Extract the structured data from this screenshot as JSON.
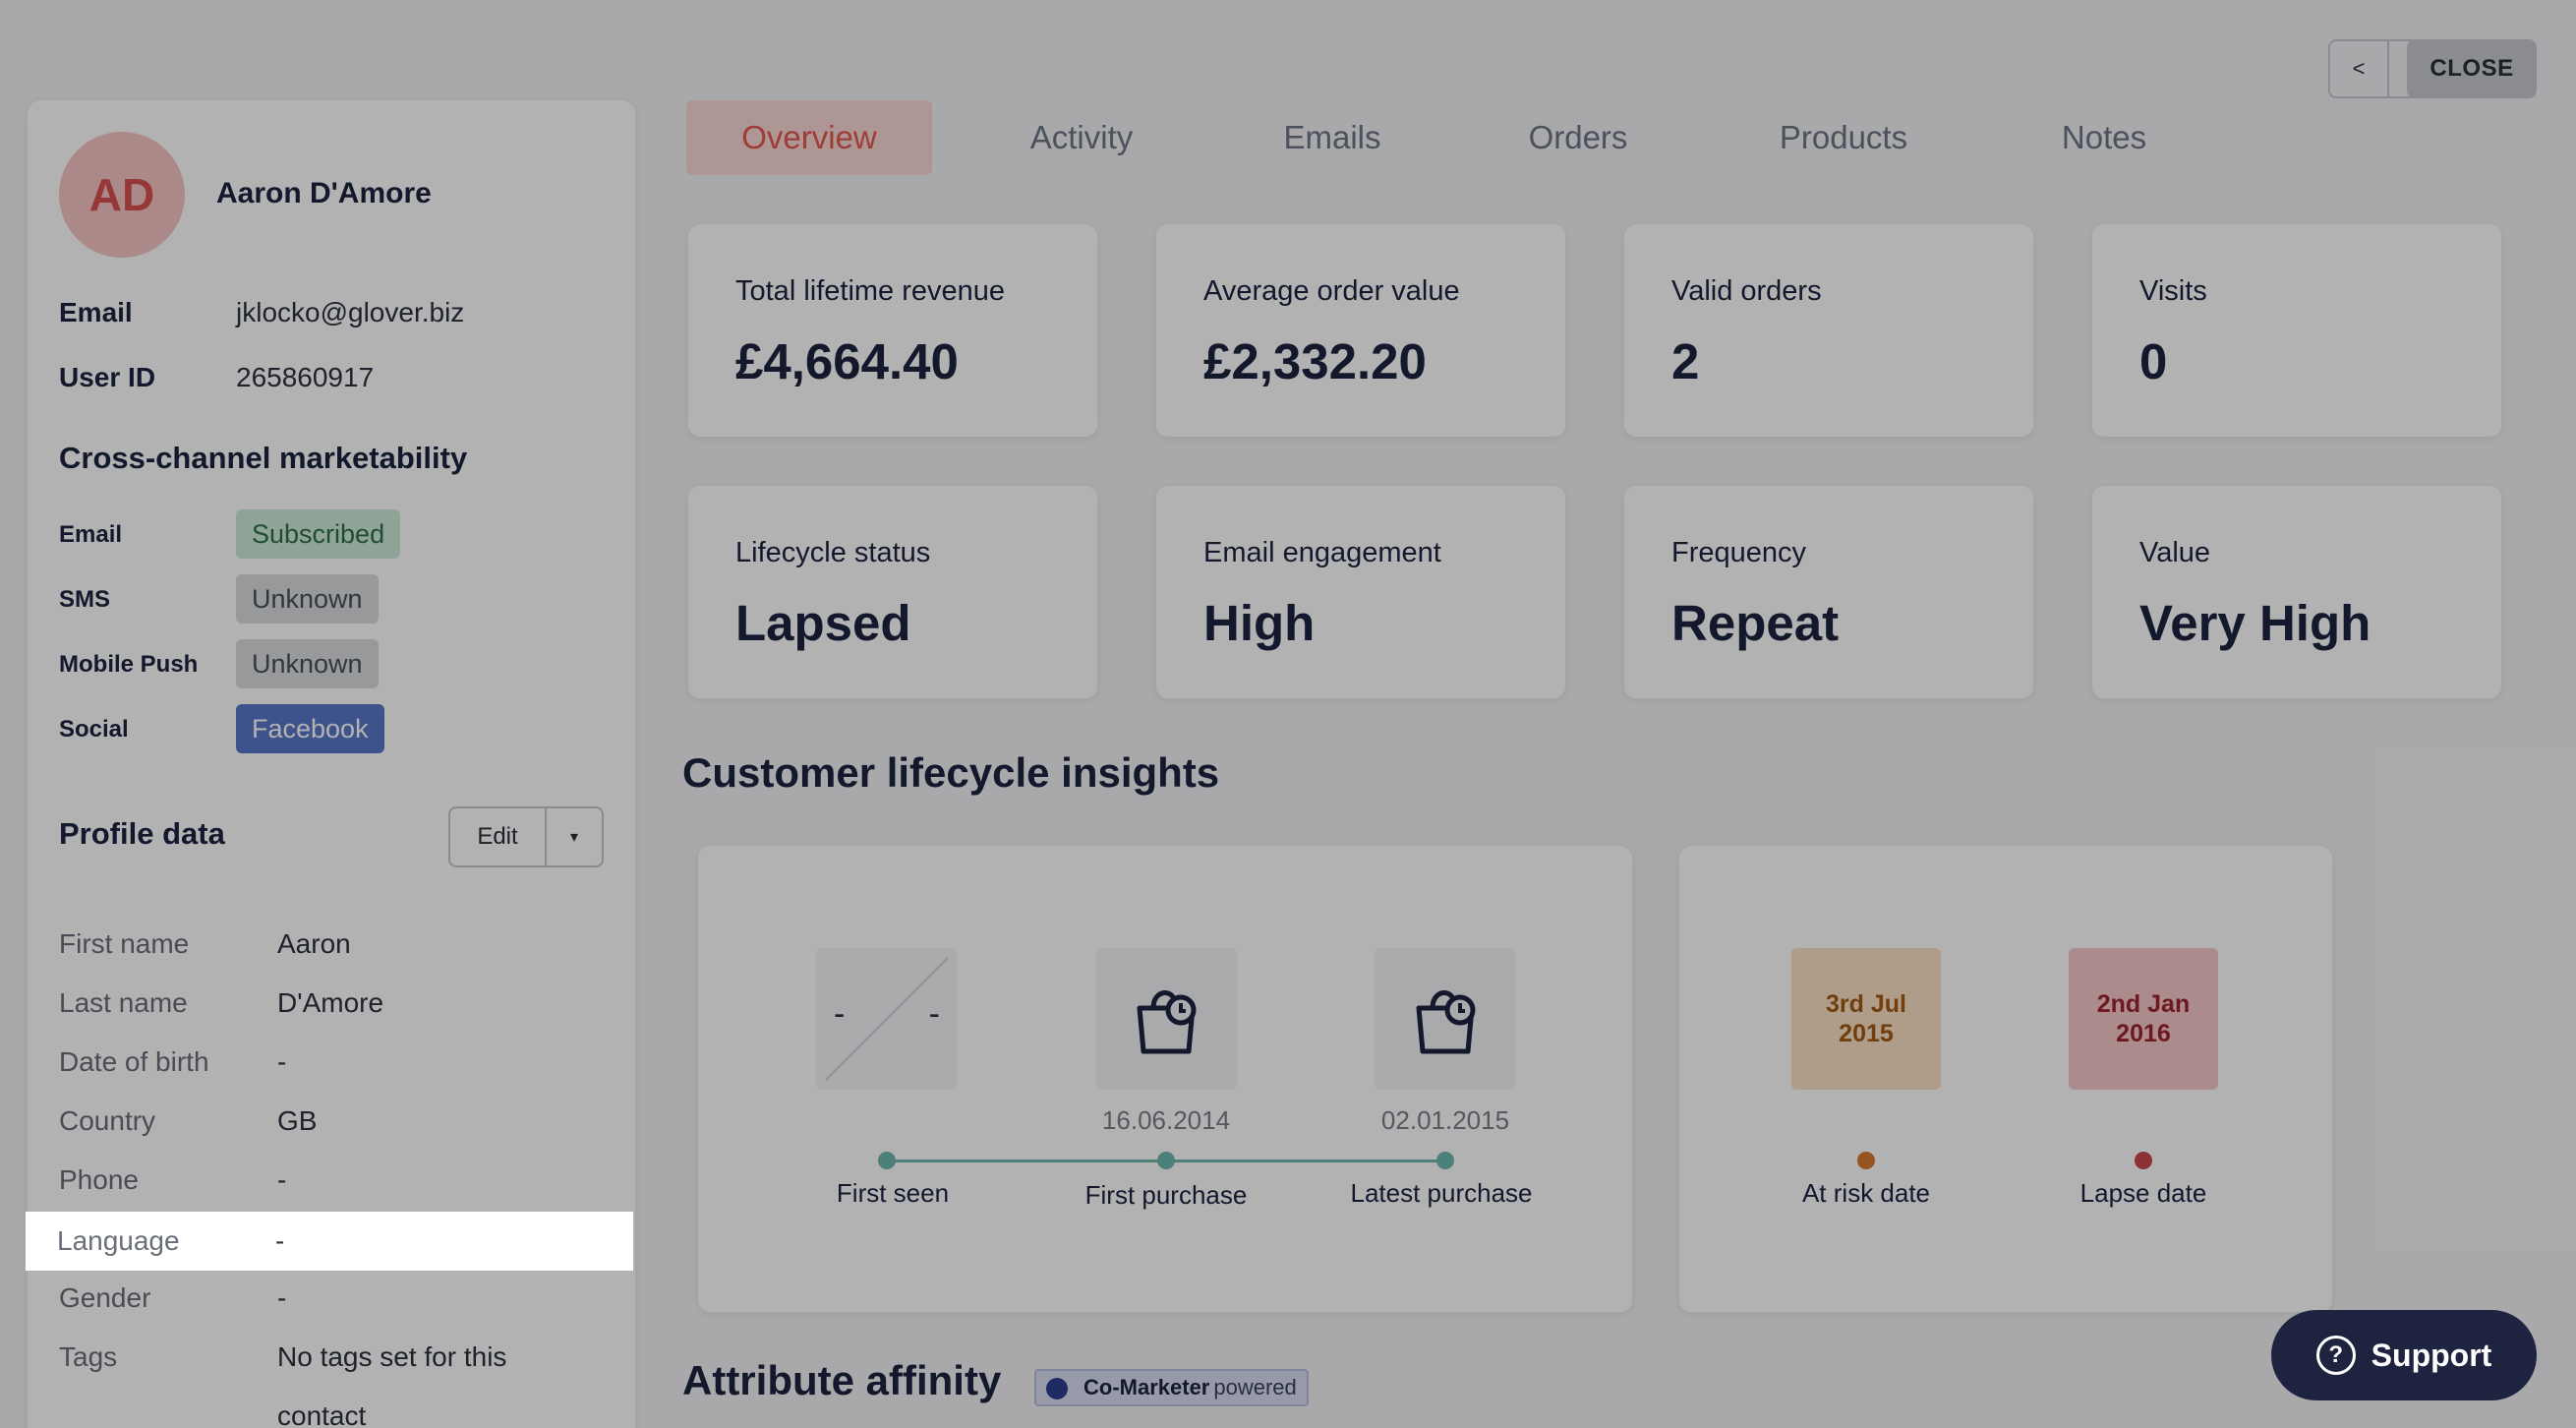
{
  "nav": {
    "prev": "<",
    "next": ">",
    "close": "CLOSE"
  },
  "profile": {
    "initials": "AD",
    "name": "Aaron D'Amore",
    "email_label": "Email",
    "email": "jklocko@glover.biz",
    "userid_label": "User ID",
    "userid": "265860917"
  },
  "marketability": {
    "title": "Cross-channel marketability",
    "channels": [
      {
        "label": "Email",
        "value": "Subscribed"
      },
      {
        "label": "SMS",
        "value": "Unknown"
      },
      {
        "label": "Mobile Push",
        "value": "Unknown"
      },
      {
        "label": "Social",
        "value": "Facebook"
      }
    ]
  },
  "profile_data": {
    "title": "Profile data",
    "edit_label": "Edit",
    "fields": [
      {
        "label": "First name",
        "value": "Aaron"
      },
      {
        "label": "Last name",
        "value": "D'Amore"
      },
      {
        "label": "Date of birth",
        "value": "-"
      },
      {
        "label": "Country",
        "value": "GB"
      },
      {
        "label": "Phone",
        "value": "-"
      },
      {
        "label": "Language",
        "value": "-"
      },
      {
        "label": "Gender",
        "value": "-"
      },
      {
        "label": "Tags",
        "value": "No tags set for this contact"
      }
    ]
  },
  "tabs": [
    "Overview",
    "Activity",
    "Emails",
    "Orders",
    "Products",
    "Notes"
  ],
  "metrics": [
    {
      "label": "Total lifetime revenue",
      "value": "£4,664.40"
    },
    {
      "label": "Average order value",
      "value": "£2,332.20"
    },
    {
      "label": "Valid orders",
      "value": "2"
    },
    {
      "label": "Visits",
      "value": "0"
    },
    {
      "label": "Lifecycle status",
      "value": "Lapsed"
    },
    {
      "label": "Email engagement",
      "value": "High"
    },
    {
      "label": "Frequency",
      "value": "Repeat"
    },
    {
      "label": "Value",
      "value": "Very High"
    }
  ],
  "lifecycle": {
    "title": "Customer lifecycle insights",
    "first_seen": {
      "label": "First seen",
      "date_left": "-",
      "date_right": "-"
    },
    "first_purchase": {
      "label": "First purchase",
      "date": "16.06.2014"
    },
    "latest_purchase": {
      "label": "Latest purchase",
      "date": "02.01.2015"
    },
    "at_risk": {
      "label": "At risk date",
      "line1": "3rd Jul",
      "line2": "2015"
    },
    "lapse": {
      "label": "Lapse date",
      "line1": "2nd Jan",
      "line2": "2016"
    }
  },
  "affinity": {
    "title": "Attribute affinity",
    "badge_strong": "Co-Marketer",
    "badge_light": "powered"
  },
  "support_label": "Support",
  "support_icon_glyph": "?",
  "colors": {
    "accent": "#e2574f",
    "at_risk": "#d77a2e",
    "lapse": "#c94850",
    "timeline": "#6fb8ac",
    "facebook": "#5a77c7"
  }
}
